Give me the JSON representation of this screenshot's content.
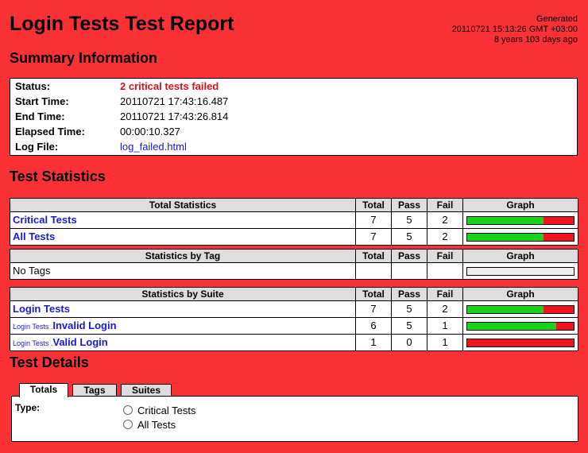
{
  "title": "Login Tests Test Report",
  "generated": {
    "label": "Generated",
    "timestamp": "20110721 15:13:26 GMT +03:00",
    "ago": "8 years 103 days ago"
  },
  "summary": {
    "heading": "Summary Information",
    "rows": [
      {
        "label": "Status:",
        "value": "2 critical tests failed"
      },
      {
        "label": "Start Time:",
        "value": "20110721 17:43:16.487"
      },
      {
        "label": "End Time:",
        "value": "20110721 17:43:26.814"
      },
      {
        "label": "Elapsed Time:",
        "value": "00:00:10.327"
      },
      {
        "label": "Log File:",
        "value": "log_failed.html"
      }
    ]
  },
  "stats": {
    "heading": "Test Statistics",
    "cols": [
      "Total",
      "Pass",
      "Fail",
      "Graph"
    ],
    "total": {
      "header": "Total Statistics",
      "rows": [
        {
          "name": "Critical Tests",
          "total": "7",
          "pass": "5",
          "fail": "2"
        },
        {
          "name": "All Tests",
          "total": "7",
          "pass": "5",
          "fail": "2"
        }
      ]
    },
    "tag": {
      "header": "Statistics by Tag",
      "empty": "No Tags"
    },
    "suite": {
      "header": "Statistics by Suite",
      "rows": [
        {
          "parent": "",
          "name": "Login Tests",
          "total": "7",
          "pass": "5",
          "fail": "2"
        },
        {
          "parent": "Login Tests .",
          "name": "Invalid Login",
          "total": "6",
          "pass": "5",
          "fail": "1"
        },
        {
          "parent": "Login Tests .",
          "name": "Valid Login",
          "total": "1",
          "pass": "0",
          "fail": "1"
        }
      ]
    }
  },
  "details": {
    "heading": "Test Details",
    "tabs": [
      "Totals",
      "Tags",
      "Suites"
    ],
    "type_label": "Type:",
    "options": [
      "Critical Tests",
      "All Tests"
    ]
  }
}
